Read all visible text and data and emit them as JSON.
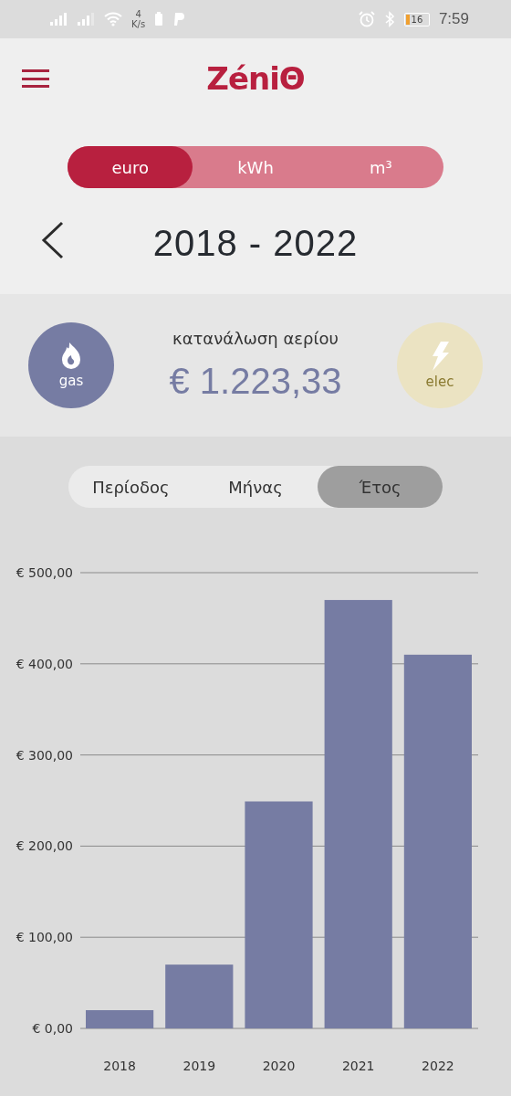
{
  "status_bar": {
    "net_speed": "4",
    "net_unit": "K/s",
    "battery": "16",
    "time": "7:59"
  },
  "header": {
    "logo": "ZéniΘ"
  },
  "units": [
    {
      "label": "euro",
      "selected": true
    },
    {
      "label": "kWh",
      "selected": false
    },
    {
      "label": "m³",
      "selected": false
    }
  ],
  "period": {
    "range": "2018 - 2022"
  },
  "summary": {
    "title": "κατανάλωση αερίου",
    "amount": "€ 1.223,33",
    "sources": [
      {
        "label": "gas",
        "kind": "gas",
        "selected": true
      },
      {
        "label": "elec",
        "kind": "elec",
        "selected": false
      }
    ]
  },
  "view_tabs": [
    {
      "label": "Περίοδος",
      "selected": false
    },
    {
      "label": "Μήνας",
      "selected": false
    },
    {
      "label": "Έτος",
      "selected": true
    }
  ],
  "chart_data": {
    "type": "bar",
    "categories": [
      "2018",
      "2019",
      "2020",
      "2021",
      "2022"
    ],
    "series": [
      {
        "color": "#767ca3",
        "values": [
          20,
          70,
          249,
          470,
          410
        ]
      }
    ],
    "grid": true,
    "ylim": [
      0,
      500
    ],
    "yticks": [
      {
        "value": 0,
        "label": "€ 0,00"
      },
      {
        "value": 100,
        "label": "€ 100,00"
      },
      {
        "value": 200,
        "label": "€ 200,00"
      },
      {
        "value": 300,
        "label": "€ 300,00"
      },
      {
        "value": 400,
        "label": "€ 400,00"
      },
      {
        "value": 500,
        "label": "€ 500,00"
      }
    ]
  }
}
